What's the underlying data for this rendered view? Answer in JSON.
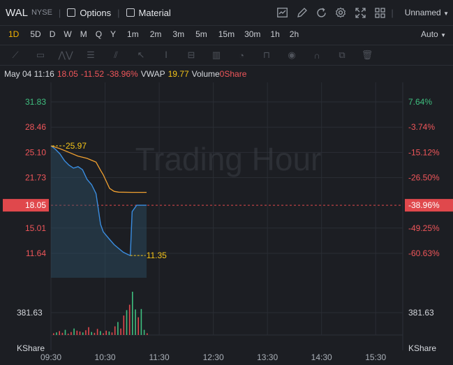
{
  "header": {
    "symbol": "WAL",
    "exchange": "NYSE",
    "options_label": "Options",
    "material_label": "Material",
    "layout_name": "Unnamed",
    "icons": [
      "chart-settings-icon",
      "draw-icon",
      "refresh-icon",
      "gear-icon",
      "fullscreen-icon",
      "grid-layout-icon"
    ]
  },
  "timeframes": [
    "1D",
    "5D",
    "D",
    "W",
    "M",
    "Q",
    "Y",
    "1m",
    "2m",
    "3m",
    "5m",
    "15m",
    "30m",
    "1h",
    "2h"
  ],
  "active_timeframe": "1D",
  "auto_label": "Auto",
  "quote": {
    "datetime": "May 04 11:16",
    "price": "18.05",
    "change": "-11.52",
    "change_pct": "-38.96%",
    "vwap_label": "VWAP",
    "vwap": "19.77",
    "volume_label": "Volume",
    "volume": "0Share"
  },
  "chart_data": {
    "type": "line",
    "watermark": "Trading Hour",
    "y_left_ticks": [
      "31.83",
      "28.46",
      "25.10",
      "21.73",
      "18.05",
      "15.01",
      "11.64"
    ],
    "y_right_ticks": [
      "7.64%",
      "-3.74%",
      "-15.12%",
      "-26.50%",
      "-38.96%",
      "-49.25%",
      "-60.63%"
    ],
    "ylim": [
      11.64,
      31.83
    ],
    "x_ticks": [
      "09:30",
      "10:30",
      "11:30",
      "12:30",
      "13:30",
      "14:30",
      "15:30"
    ],
    "volume_tick": "381.63",
    "volume_unit": "KShare",
    "high_label": "25.97",
    "low_label": "11.35",
    "current_price": 18.05,
    "series": [
      {
        "name": "price",
        "color": "#3a8de0",
        "x": [
          "09:30",
          "09:35",
          "09:40",
          "09:45",
          "09:50",
          "09:55",
          "10:00",
          "10:05",
          "10:10",
          "10:15",
          "10:20",
          "10:25",
          "10:28",
          "10:35",
          "10:40",
          "10:45",
          "10:50",
          "10:55",
          "10:58",
          "11:00",
          "11:05",
          "11:10",
          "11:16"
        ],
        "values": [
          25.97,
          25.5,
          24.9,
          24.0,
          23.4,
          23.0,
          23.2,
          22.8,
          21.5,
          20.8,
          19.6,
          15.5,
          14.5,
          13.5,
          12.8,
          12.3,
          11.8,
          11.5,
          11.35,
          17.2,
          18.05,
          18.05,
          18.05
        ]
      },
      {
        "name": "VWAP",
        "color": "#f0a030",
        "x": [
          "09:30",
          "09:40",
          "09:50",
          "10:00",
          "10:10",
          "10:20",
          "10:25",
          "10:28",
          "10:35",
          "10:40",
          "10:45",
          "11:00",
          "11:16"
        ],
        "values": [
          25.97,
          25.6,
          25.1,
          24.6,
          24.3,
          23.8,
          22.7,
          22.1,
          20.3,
          19.9,
          19.8,
          19.77,
          19.77
        ]
      }
    ],
    "volume": [
      8,
      12,
      18,
      10,
      24,
      6,
      14,
      30,
      20,
      16,
      12,
      22,
      36,
      14,
      10,
      28,
      18,
      8,
      20,
      16,
      12,
      40,
      60,
      30,
      90,
      115,
      140,
      200,
      118,
      82,
      120,
      24,
      8
    ]
  }
}
